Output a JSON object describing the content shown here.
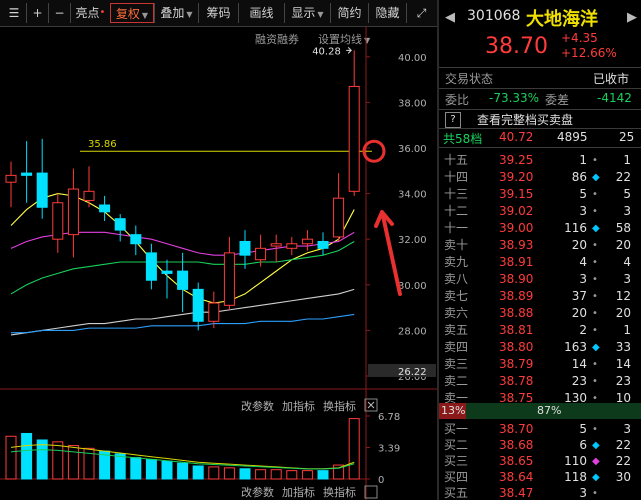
{
  "toolbar": {
    "items": [
      {
        "label": "",
        "icon": "menu-icon"
      },
      {
        "label": "+",
        "icon": "zoom-in-icon"
      },
      {
        "label": "−",
        "icon": "zoom-out-icon"
      },
      {
        "label": "亮点",
        "marker": "•"
      },
      {
        "label": "复权",
        "highlighted": true
      },
      {
        "label": "叠加"
      },
      {
        "label": "筹码"
      },
      {
        "label": "画线"
      },
      {
        "label": "显示"
      },
      {
        "label": "简约"
      },
      {
        "label": "隐藏"
      }
    ],
    "sub_links": [
      "融资融券",
      "设置均线"
    ]
  },
  "price_chart": {
    "high_label": "40.28",
    "line_label": "35.86",
    "current_price_box": "26.22",
    "y_ticks": [
      "40.00",
      "38.00",
      "36.00",
      "34.00",
      "32.00",
      "30.00",
      "28.00",
      "26.00"
    ]
  },
  "indicator_panel": {
    "buttons_top": [
      "改参数",
      "加指标",
      "换指标"
    ],
    "buttons_bottom": [
      "改参数",
      "加指标",
      "换指标"
    ],
    "y_ticks": [
      "6.78",
      "3.39",
      "0"
    ]
  },
  "chart_data": {
    "type": "candlestick",
    "title": "",
    "ylim": [
      26,
      41
    ],
    "candles": [
      {
        "o": 34.5,
        "c": 34.8,
        "h": 35.4,
        "l": 33.4
      },
      {
        "o": 34.9,
        "c": 34.8,
        "h": 36.3,
        "l": 33.6
      },
      {
        "o": 34.9,
        "c": 33.4,
        "h": 36.4,
        "l": 32.9
      },
      {
        "o": 32.0,
        "c": 33.6,
        "h": 34.0,
        "l": 31.4
      },
      {
        "o": 32.2,
        "c": 34.2,
        "h": 35.1,
        "l": 31.2
      },
      {
        "o": 33.7,
        "c": 34.1,
        "h": 35.2,
        "l": 33.4
      },
      {
        "o": 33.5,
        "c": 33.2,
        "h": 33.9,
        "l": 32.8
      },
      {
        "o": 32.9,
        "c": 32.4,
        "h": 33.1,
        "l": 31.9
      },
      {
        "o": 32.2,
        "c": 31.8,
        "h": 32.6,
        "l": 31.3
      },
      {
        "o": 31.4,
        "c": 30.2,
        "h": 31.8,
        "l": 29.8
      },
      {
        "o": 30.6,
        "c": 30.5,
        "h": 31.1,
        "l": 29.4
      },
      {
        "o": 30.6,
        "c": 29.8,
        "h": 31.4,
        "l": 28.8
      },
      {
        "o": 29.8,
        "c": 28.4,
        "h": 30.1,
        "l": 28.0
      },
      {
        "o": 28.4,
        "c": 29.2,
        "h": 29.7,
        "l": 28.1
      },
      {
        "o": 29.1,
        "c": 31.4,
        "h": 32.1,
        "l": 28.9
      },
      {
        "o": 31.9,
        "c": 31.3,
        "h": 32.4,
        "l": 30.7
      },
      {
        "o": 31.1,
        "c": 31.6,
        "h": 32.2,
        "l": 30.8
      },
      {
        "o": 31.7,
        "c": 31.8,
        "h": 32.2,
        "l": 31.0
      },
      {
        "o": 31.6,
        "c": 31.8,
        "h": 32.1,
        "l": 31.3
      },
      {
        "o": 31.8,
        "c": 32.0,
        "h": 32.4,
        "l": 31.5
      },
      {
        "o": 31.9,
        "c": 31.6,
        "h": 32.3,
        "l": 31.3
      },
      {
        "o": 32.1,
        "c": 33.8,
        "h": 34.9,
        "l": 31.9
      },
      {
        "o": 34.1,
        "c": 38.7,
        "h": 40.28,
        "l": 33.9
      }
    ],
    "ma_lines": [
      {
        "color": "#ffff40",
        "values": [
          32.6,
          33.3,
          33.8,
          34.0,
          33.9,
          33.6,
          33.2,
          32.6,
          31.9,
          31.1,
          30.4,
          29.8,
          29.4,
          29.2,
          29.3,
          29.6,
          30.1,
          30.6,
          31.1,
          31.4,
          31.6,
          32.0,
          33.3
        ]
      },
      {
        "color": "#e040e0",
        "values": [
          31.6,
          31.9,
          32.1,
          32.2,
          32.3,
          32.3,
          32.3,
          32.2,
          32.1,
          32.0,
          31.8,
          31.6,
          31.4,
          31.3,
          31.3,
          31.4,
          31.5,
          31.6,
          31.7,
          31.7,
          31.8,
          31.9,
          32.3
        ]
      },
      {
        "color": "#19d05a",
        "values": [
          29.6,
          30.0,
          30.3,
          30.5,
          30.7,
          30.8,
          30.9,
          31.0,
          31.0,
          31.0,
          31.0,
          31.0,
          31.0,
          30.9,
          30.9,
          30.9,
          31.0,
          31.0,
          31.1,
          31.2,
          31.3,
          31.5,
          31.9
        ]
      },
      {
        "color": "#d0d0d0",
        "values": [
          27.8,
          27.9,
          28.0,
          28.1,
          28.2,
          28.3,
          28.3,
          28.4,
          28.5,
          28.5,
          28.6,
          28.7,
          28.8,
          28.8,
          28.9,
          29.0,
          29.1,
          29.2,
          29.3,
          29.4,
          29.5,
          29.6,
          29.8
        ]
      },
      {
        "color": "#2aa0ff",
        "values": [
          27.9,
          27.9,
          28.0,
          28.0,
          28.0,
          28.1,
          28.1,
          28.1,
          28.1,
          28.2,
          28.2,
          28.2,
          28.2,
          28.3,
          28.3,
          28.3,
          28.4,
          28.4,
          28.4,
          28.5,
          28.5,
          28.6,
          28.7
        ]
      }
    ],
    "volume": [
      4.6,
      4.9,
      4.2,
      4.0,
      3.6,
      3.3,
      3.0,
      2.7,
      2.3,
      2.1,
      1.9,
      1.7,
      1.4,
      1.3,
      1.2,
      1.1,
      1.0,
      1.0,
      0.9,
      0.9,
      0.9,
      1.5,
      6.5
    ],
    "volume_ylim": [
      0,
      6.78
    ],
    "volume_ma": [
      3.4,
      3.6,
      3.7,
      3.6,
      3.4,
      3.2,
      3.0,
      2.8,
      2.6,
      2.4,
      2.2,
      2.0,
      1.8,
      1.7,
      1.6,
      1.5,
      1.4,
      1.3,
      1.2,
      1.1,
      1.1,
      1.2,
      1.8
    ]
  },
  "quote": {
    "code": "301068",
    "name": "大地海洋",
    "price": "38.70",
    "change": "+4.35",
    "change_pct": "+12.66%",
    "status_label": "交易状态",
    "status_value": "已收市",
    "weibi_label": "委比",
    "weibi_value": "-73.33%",
    "weicha_label": "委差",
    "weicha_value": "-4142",
    "full_book_link": "查看完整档买卖盘",
    "total_label": "共58档",
    "total_price": "40.72",
    "total_vol": "4895",
    "total_cnt": "25"
  },
  "asks": [
    {
      "label": "十五",
      "price": "39.25",
      "vol": "1",
      "cnt": "1",
      "mark": "dot"
    },
    {
      "label": "十四",
      "price": "39.20",
      "vol": "86",
      "cnt": "22",
      "mark": "diamond"
    },
    {
      "label": "十三",
      "price": "39.15",
      "vol": "5",
      "cnt": "5",
      "mark": "dot"
    },
    {
      "label": "十二",
      "price": "39.02",
      "vol": "3",
      "cnt": "3",
      "mark": "dot"
    },
    {
      "label": "十一",
      "price": "39.00",
      "vol": "116",
      "cnt": "58",
      "mark": "diamond"
    },
    {
      "label": "卖十",
      "price": "38.93",
      "vol": "20",
      "cnt": "20",
      "mark": "dot"
    },
    {
      "label": "卖九",
      "price": "38.91",
      "vol": "4",
      "cnt": "4",
      "mark": "dot"
    },
    {
      "label": "卖八",
      "price": "38.90",
      "vol": "3",
      "cnt": "3",
      "mark": "dot"
    },
    {
      "label": "卖七",
      "price": "38.89",
      "vol": "37",
      "cnt": "12",
      "mark": "dot"
    },
    {
      "label": "卖六",
      "price": "38.88",
      "vol": "20",
      "cnt": "20",
      "mark": "dot"
    },
    {
      "label": "卖五",
      "price": "38.81",
      "vol": "2",
      "cnt": "1",
      "mark": "dot"
    },
    {
      "label": "卖四",
      "price": "38.80",
      "vol": "163",
      "cnt": "33",
      "mark": "diamond"
    },
    {
      "label": "卖三",
      "price": "38.79",
      "vol": "14",
      "cnt": "14",
      "mark": "dot"
    },
    {
      "label": "卖二",
      "price": "38.78",
      "vol": "23",
      "cnt": "23",
      "mark": "dot"
    },
    {
      "label": "卖一",
      "price": "38.75",
      "vol": "130",
      "cnt": "10",
      "mark": "dot"
    }
  ],
  "ratio_bar": {
    "left": "13%",
    "right": "87%"
  },
  "bids": [
    {
      "label": "买一",
      "price": "38.70",
      "vol": "5",
      "cnt": "3",
      "mark": "dot"
    },
    {
      "label": "买二",
      "price": "38.68",
      "vol": "6",
      "cnt": "22",
      "mark": "diamond"
    },
    {
      "label": "买三",
      "price": "38.65",
      "vol": "110",
      "cnt": "22",
      "mark": "dot-magenta"
    },
    {
      "label": "买四",
      "price": "38.64",
      "vol": "118",
      "cnt": "30",
      "mark": "diamond"
    },
    {
      "label": "买五",
      "price": "38.47",
      "vol": "3",
      "cnt": "",
      "mark": "dot"
    }
  ]
}
